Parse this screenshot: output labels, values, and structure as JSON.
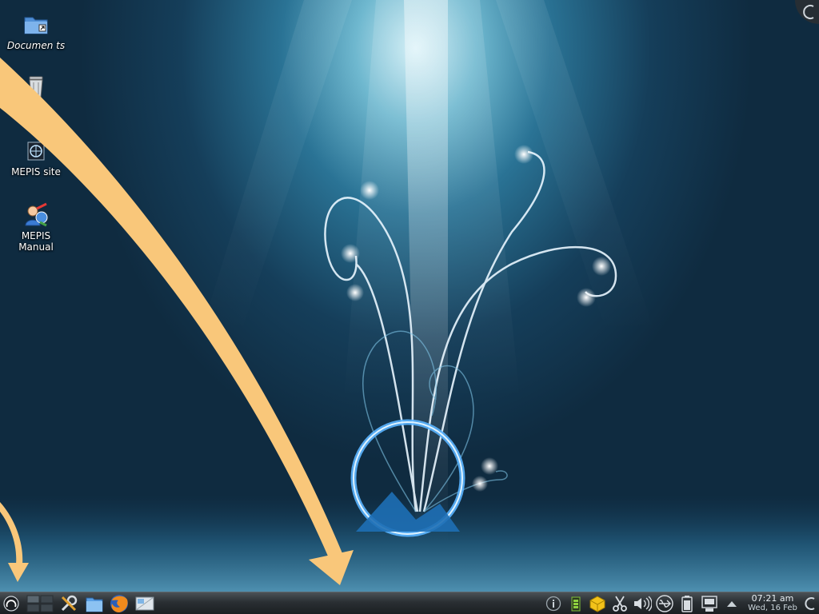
{
  "desktop": {
    "icons": [
      {
        "label": "Documen ts",
        "icon": "folder-icon"
      },
      {
        "label": "Trash",
        "icon": "trash-icon"
      },
      {
        "label": "MEPIS site",
        "icon": "web-link-icon"
      },
      {
        "label": "MEPIS Manual",
        "icon": "help-manual-icon"
      }
    ]
  },
  "annotations": {
    "arrow_color": "#f9c77a"
  },
  "taskbar": {
    "launcher": {
      "icon": "kde-menu-icon"
    },
    "quicklaunch": [
      {
        "icon": "pager-icon"
      },
      {
        "icon": "system-settings-icon"
      },
      {
        "icon": "file-manager-icon"
      },
      {
        "icon": "firefox-icon"
      },
      {
        "icon": "show-desktop-icon"
      }
    ],
    "tray": [
      {
        "icon": "info-icon"
      },
      {
        "icon": "battery-monitor-icon"
      },
      {
        "icon": "package-updater-icon"
      },
      {
        "icon": "klipper-scissors-icon"
      },
      {
        "icon": "volume-icon"
      },
      {
        "icon": "usb-device-icon"
      },
      {
        "icon": "battery-icon"
      },
      {
        "icon": "network-icon"
      },
      {
        "icon": "tray-expand-icon"
      }
    ],
    "clock": {
      "time": "07:21 am",
      "date": "Wed, 16 Feb"
    }
  }
}
